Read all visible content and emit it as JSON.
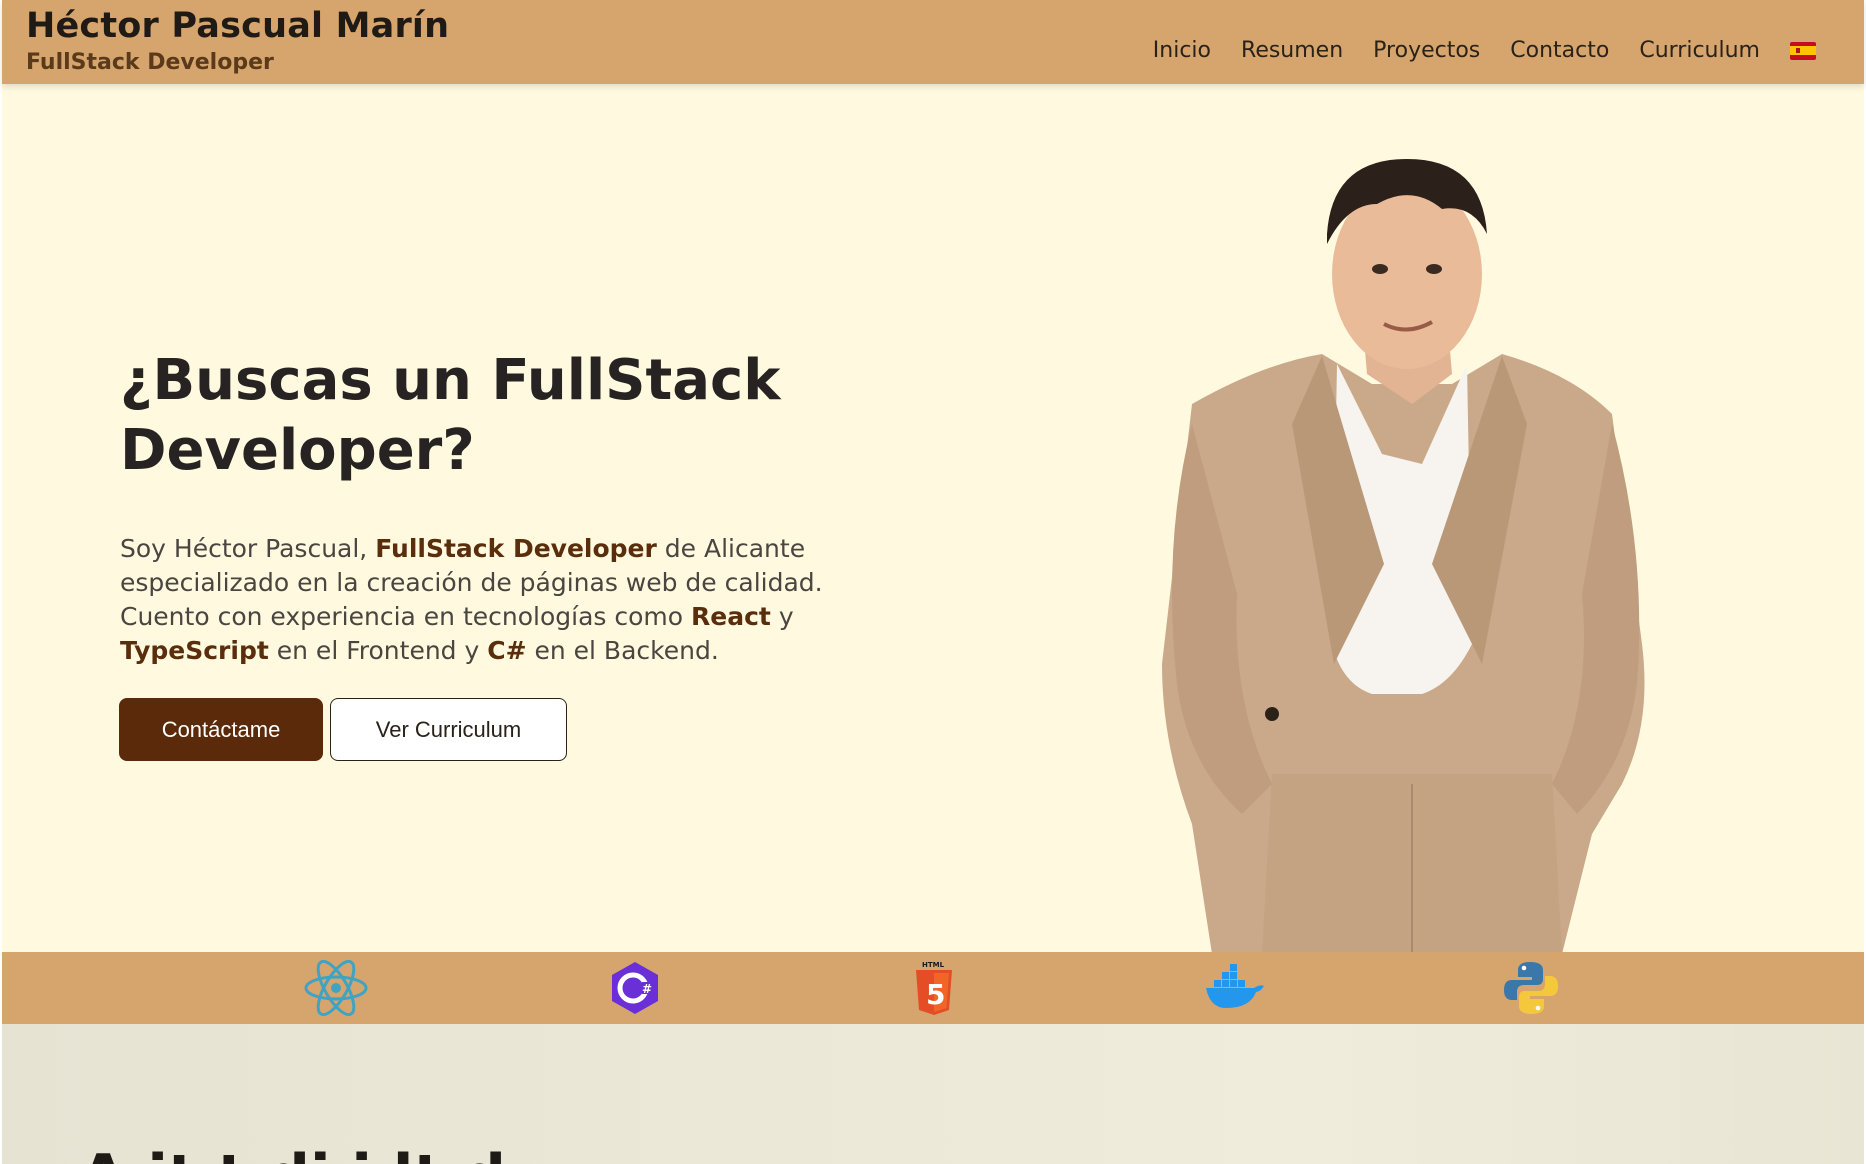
{
  "header": {
    "name": "Héctor Pascual Marín",
    "role": "FullStack Developer",
    "nav": [
      "Inicio",
      "Resumen",
      "Proyectos",
      "Contacto",
      "Curriculum"
    ],
    "language_flag": "spain-flag-icon"
  },
  "hero": {
    "title": "¿Buscas un FullStack Developer?",
    "intro": {
      "p1": "Soy Héctor Pascual, ",
      "h1": "FullStack Developer",
      "p2": " de Alicante especializado en la creación de páginas web de calidad. Cuento con experiencia en tecnologías como ",
      "h2": "React",
      "p3": " y ",
      "h3": "TypeScript",
      "p4": " en el Frontend y ",
      "h4": "C#",
      "p5": " en el Backend."
    },
    "buttons": {
      "primary": "Contáctame",
      "secondary": "Ver Curriculum"
    }
  },
  "tech_icons": [
    "react-icon",
    "csharp-icon",
    "html5-icon",
    "docker-icon",
    "python-icon"
  ],
  "next_section": {
    "title": "A     it  t     di  i      lt d"
  },
  "colors": {
    "header_bg": "#d6a56d",
    "hero_bg": "#fffadf",
    "accent": "#5a2a0b"
  }
}
